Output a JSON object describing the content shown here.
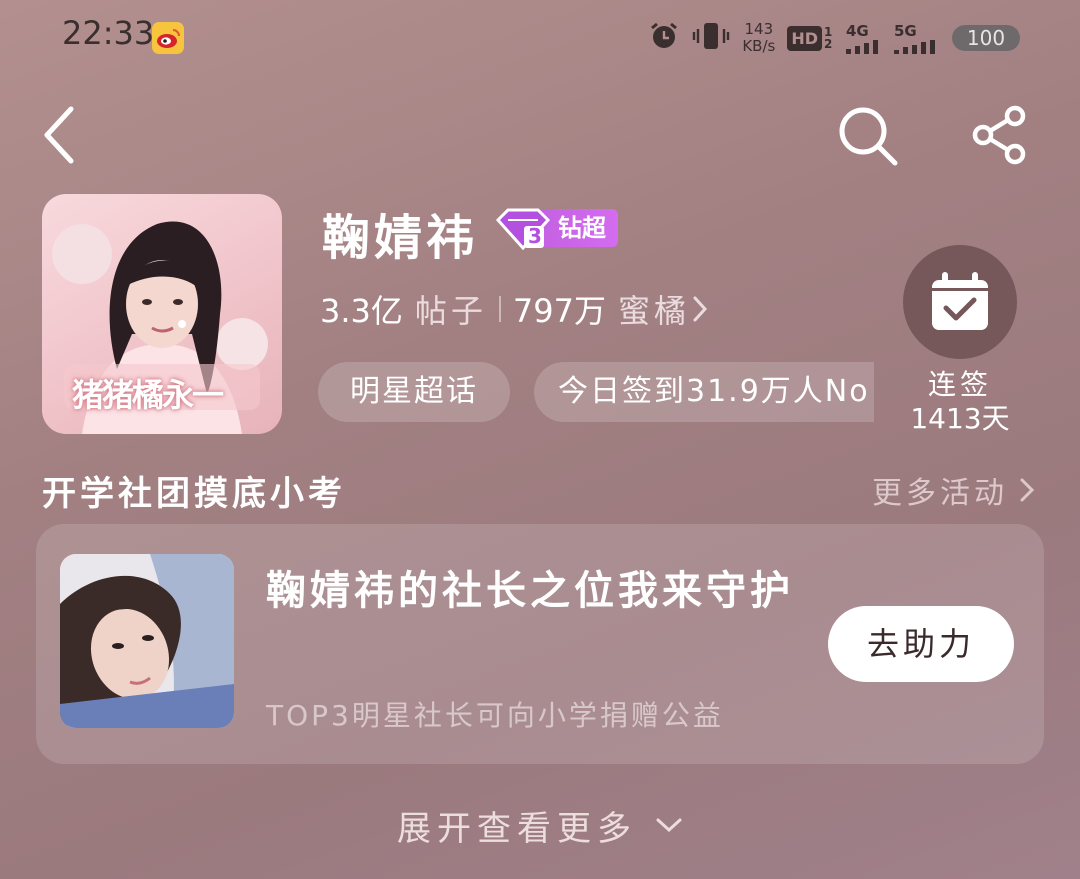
{
  "status_bar": {
    "time": "22:33",
    "net_speed_value": "143",
    "net_speed_unit": "KB/s",
    "hd_label": "HD",
    "hd_sub": "1 2",
    "network_1": "4G",
    "network_2": "5G",
    "battery": "100"
  },
  "header": {
    "topic_name": "鞠婧祎",
    "level_badge": "钻超",
    "level_number": "3",
    "posts_count": "3.3亿",
    "posts_unit": "帖子",
    "fans_count": "797万",
    "fans_unit": "蜜橘",
    "avatar_caption": "猪猪橘永一",
    "tags": [
      "明星超话",
      "今日签到31.9万人No"
    ],
    "checkin_label": "连签",
    "checkin_days": "1413天"
  },
  "section": {
    "title": "开学社团摸底小考",
    "more_link": "更多活动"
  },
  "activity": {
    "title": "鞠婧祎的社长之位我来守护",
    "subtitle": "TOP3明星社长可向小学捐赠公益",
    "action": "去助力"
  },
  "footer": {
    "expand_label": "展开查看更多"
  }
}
